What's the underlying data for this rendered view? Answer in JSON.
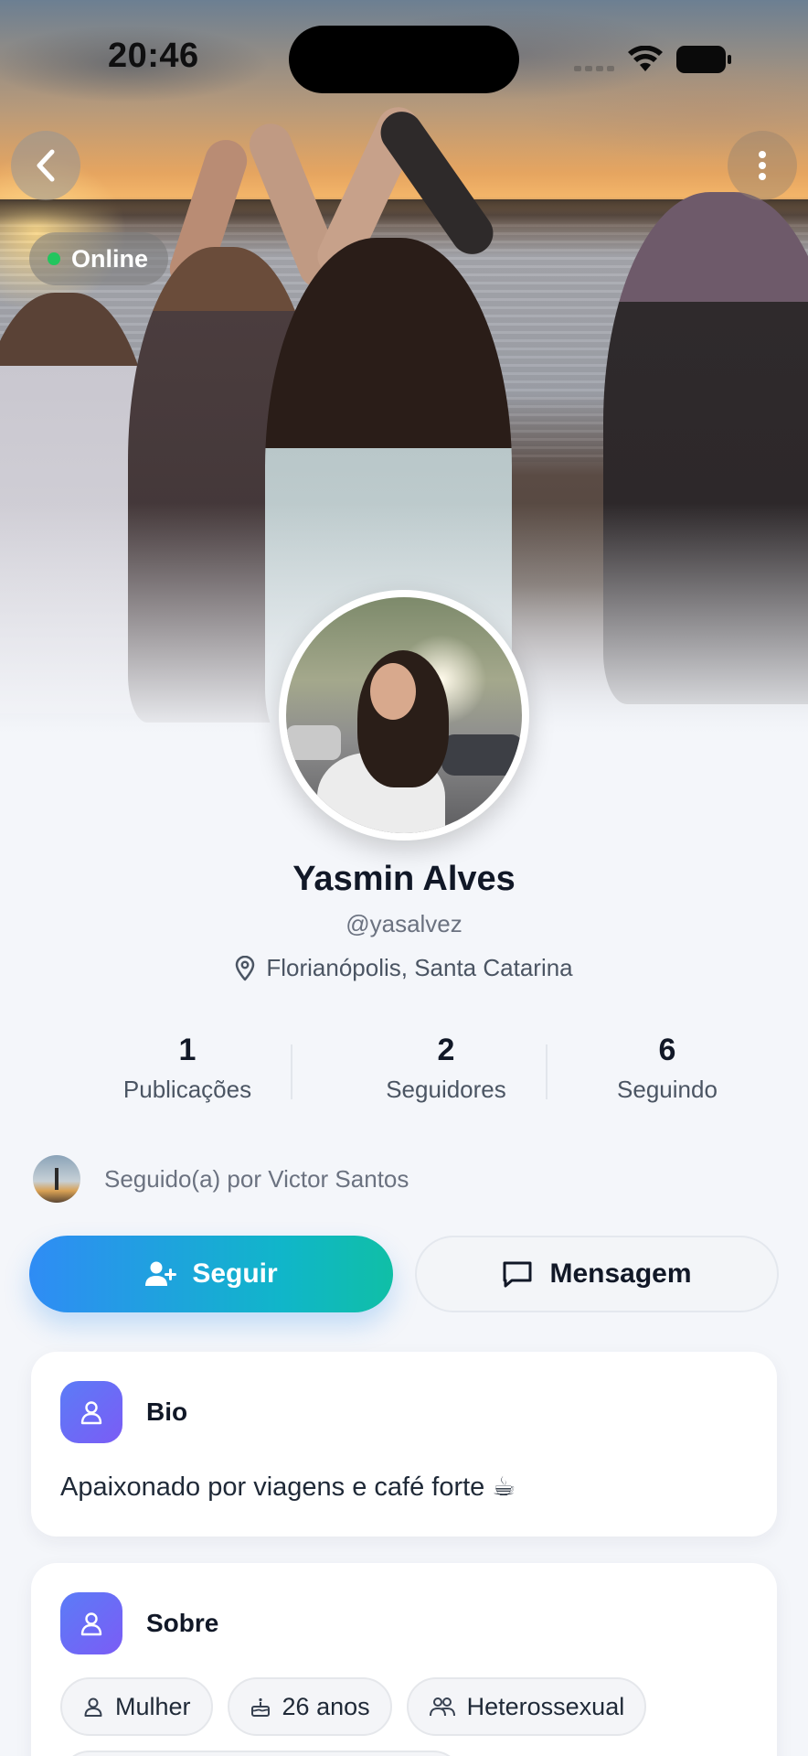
{
  "status_bar": {
    "time": "20:46"
  },
  "profile": {
    "online_label": "Online",
    "name": "Yasmin Alves",
    "handle": "@yasalvez",
    "location": "Florianópolis, Santa Catarina"
  },
  "stats": [
    {
      "value": "1",
      "label": "Publicações"
    },
    {
      "value": "2",
      "label": "Seguidores"
    },
    {
      "value": "6",
      "label": "Seguindo"
    }
  ],
  "followed_by": "Seguido(a) por Victor Santos",
  "actions": {
    "follow_label": "Seguir",
    "message_label": "Mensagem"
  },
  "bio": {
    "title": "Bio",
    "text": "Apaixonado por viagens e café forte ☕"
  },
  "about": {
    "title": "Sobre",
    "chips": [
      {
        "icon": "person-icon",
        "label": "Mulher"
      },
      {
        "icon": "cake-icon",
        "label": "26 anos"
      },
      {
        "icon": "people-icon",
        "label": "Heterossexual"
      }
    ]
  },
  "colors": {
    "online": "#22c55e",
    "follow_gradient_start": "#2f8cf5",
    "follow_gradient_end": "#10bfa6",
    "card_icon_gradient_start": "#5b7cf7",
    "card_icon_gradient_end": "#7b5cf5",
    "page_background": "#f4f6fa"
  }
}
